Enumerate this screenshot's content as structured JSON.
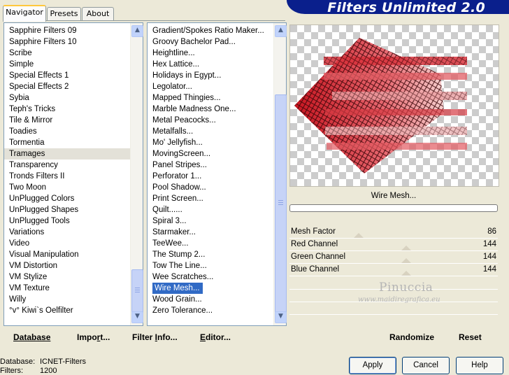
{
  "title": "Filters Unlimited 2.0",
  "tabs": [
    {
      "label": "Navigator",
      "active": true
    },
    {
      "label": "Presets",
      "active": false
    },
    {
      "label": "About",
      "active": false
    }
  ],
  "categories": {
    "items": [
      "Sapphire Filters 09",
      "Sapphire Filters 10",
      "Scribe",
      "Simple",
      "Special Effects 1",
      "Special Effects 2",
      "Sybia",
      "Teph's Tricks",
      "Tile & Mirror",
      "Toadies",
      "Tormentia",
      "Tramages",
      "Transparency",
      "Tronds Filters II",
      "Two Moon",
      "UnPlugged Colors",
      "UnPlugged Shapes",
      "UnPlugged Tools",
      "Variations",
      "Video",
      "Visual Manipulation",
      "VM Distortion",
      "VM Stylize",
      "VM Texture",
      "Willy",
      "°v° Kiwi`s Oelfilter"
    ],
    "selected": "Tramages"
  },
  "filters": {
    "items": [
      "Gradient/Spokes Ratio Maker...",
      "Groovy Bachelor Pad...",
      "Heightline...",
      "Hex Lattice...",
      "Holidays in Egypt...",
      "Legolator...",
      "Mapped Thingies...",
      "Marble Madness One...",
      "Metal Peacocks...",
      "Metalfalls...",
      "Mo' Jellyfish...",
      "MovingScreen...",
      "Panel Stripes...",
      "Perforator 1...",
      "Pool Shadow...",
      "Print Screen...",
      "Quilt......",
      "Spiral 3...",
      "Starmaker...",
      "TeeWee...",
      "The Stump 2...",
      "Tow The Line...",
      "Wee Scratches...",
      "Wire Mesh...",
      "Wood Grain...",
      "Zero Tolerance..."
    ],
    "selected": "Wire Mesh..."
  },
  "effect_name": "Wire Mesh...",
  "progress": 0,
  "params": [
    {
      "name": "Mesh Factor",
      "value": 86
    },
    {
      "name": "Red Channel",
      "value": 144
    },
    {
      "name": "Green Channel",
      "value": 144
    },
    {
      "name": "Blue Channel",
      "value": 144
    }
  ],
  "watermark": {
    "name": "Pinuccia",
    "url": "www.maidiregrafica.eu"
  },
  "links": {
    "database": "Database",
    "import_pre": "Impo",
    "import_ul": "r",
    "import_post": "t...",
    "filter_info_pre": "Filter ",
    "filter_info_ul": "I",
    "filter_info_post": "nfo...",
    "editor_pre": "",
    "editor_ul": "E",
    "editor_post": "ditor...",
    "randomize": "Randomize",
    "reset": "Reset"
  },
  "status": {
    "database_label": "Database:",
    "database_value": "ICNET-Filters",
    "filters_label": "Filters:",
    "filters_value": "1200"
  },
  "buttons": {
    "apply": "Apply",
    "cancel": "Cancel",
    "help": "Help"
  },
  "colors": {
    "banner": "#0a1f8c",
    "selection": "#316ac5",
    "mesh": "#d11a2a"
  }
}
